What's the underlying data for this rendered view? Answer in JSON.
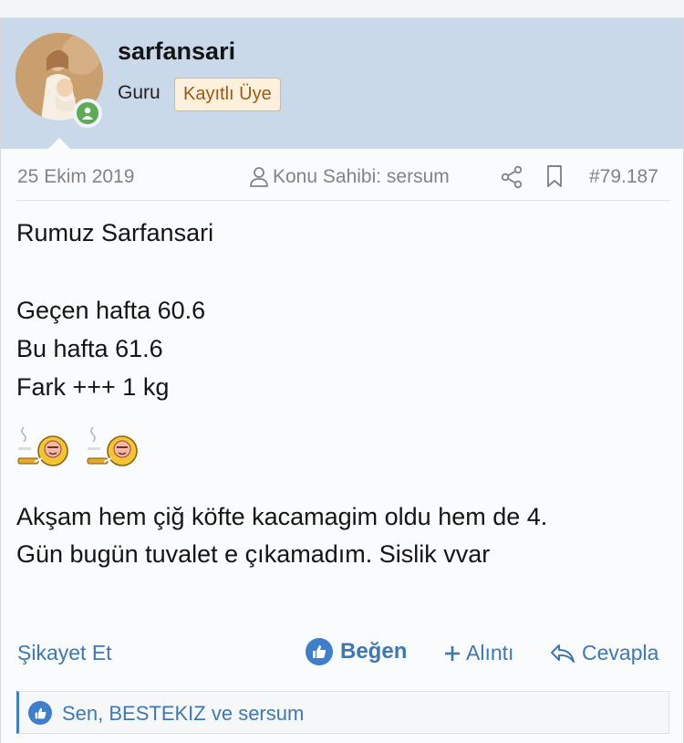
{
  "user": {
    "username": "sarfansari",
    "role": "Guru",
    "badge": "Kayıtlı Üye"
  },
  "meta": {
    "date": "25 Ekim 2019",
    "owner": "Konu Sahibi: sersum",
    "post_number": "#79.187"
  },
  "post": {
    "lines": [
      "Rumuz Sarfansari",
      "Geçen hafta 60.6",
      "Bu hafta 61.6",
      "Fark +++ 1 kg",
      "Akşam hem çiğ köfte kacamagim oldu hem de 4.",
      "Gün bugün tuvalet e çıkamadım. Sislik vvar"
    ]
  },
  "actions": {
    "report": "Şikayet Et",
    "like": "Beğen",
    "quote": "Alıntı",
    "reply": "Cevapla"
  },
  "reactions": {
    "text": "Sen, BESTEKIZ ve sersum"
  },
  "icons": [
    "user-icon",
    "share-icon",
    "bookmark-icon",
    "smoking-smiley-icon",
    "thumbs-up-icon",
    "plus-icon",
    "reply-icon",
    "online-status-icon"
  ],
  "colors": {
    "header_bg": "#c9d9ea",
    "link": "#3d78b4",
    "badge_bg": "#fdf0dc",
    "badge_text": "#9a5a16",
    "online": "#5dab55"
  }
}
